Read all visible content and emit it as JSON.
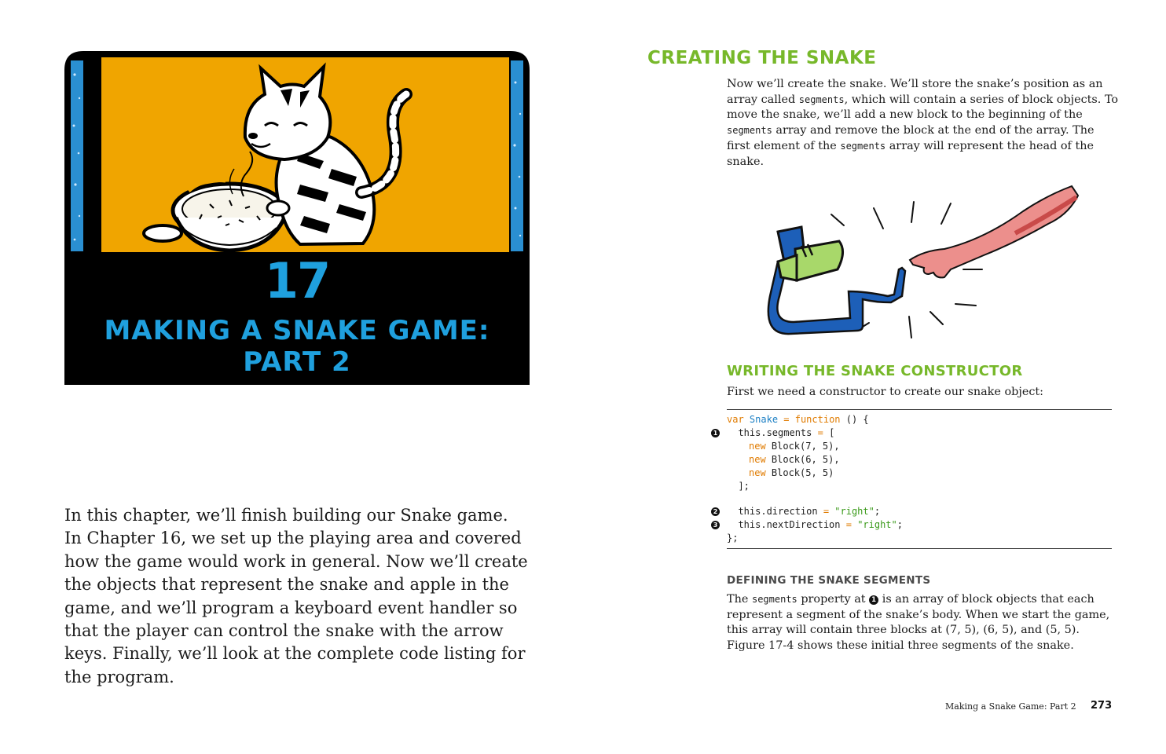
{
  "left_page": {
    "chapter_number": "17",
    "chapter_title_line1": "MAKING A SNAKE GAME:",
    "chapter_title_line2": "PART 2",
    "intro": "In this chapter, we’ll finish building our Snake game. In Chapter 16, we set up the playing area and covered how the game would work in general. Now we’ll create the objects that represent the snake and apple in the game, and we’ll program a keyboard event handler so that the player can control the snake with the arrow keys. Finally, we’ll look at the complete code listing for the program."
  },
  "right_page": {
    "heading": "CREATING THE SNAKE",
    "para1": {
      "a": "Now we’ll create the snake. We’ll store the snake’s position as an array called ",
      "code1": "segments",
      "b": ", which will contain a series of block objects. To move the snake, we’ll add a new block to the beginning of the ",
      "code2": "segments",
      "c": " array and remove the block at the end of the array. The first element of the ",
      "code3": "segments",
      "d": " array will represent the head of the snake."
    },
    "subheading": "WRITING THE SNAKE CONSTRUCTOR",
    "para2": "First we need a constructor to create our snake object:",
    "code": {
      "l1_kw": "var",
      "l1_name": "Snake",
      "l1_eq": " = ",
      "l1_fn": "function",
      "l1_rest": " () {",
      "l2_obj": "  this.segments",
      "l2_eq": " = ",
      "l2_rest": "[",
      "l3_kw": "new",
      "l3_rest": " Block(7, 5),",
      "l4_kw": "new",
      "l4_rest": " Block(6, 5),",
      "l5_kw": "new",
      "l5_rest": " Block(5, 5)",
      "l6": "  ];",
      "l7_obj": "  this.direction",
      "l7_eq": " = ",
      "l7_str": "\"right\"",
      "l7_end": ";",
      "l8_obj": "  this.nextDirection",
      "l8_eq": " = ",
      "l8_str": "\"right\"",
      "l8_end": ";",
      "l9": "};",
      "markers": [
        "1",
        "2",
        "3"
      ]
    },
    "subsubheading": "DEFINING THE SNAKE SEGMENTS",
    "para3": {
      "a": "The ",
      "code1": "segments",
      "b": " property at ",
      "marker": "1",
      "c": " is an array of block objects that each represent a segment of the snake’s body. When we start the game, this array will contain three blocks at (7, 5), (6, 5), and (5, 5). Figure 17-4 shows these initial three segments of the snake."
    },
    "footer_title": "Making a Snake Game: Part 2",
    "page_number": "273"
  },
  "colors": {
    "accent_blue": "#1fa0de",
    "heading_green": "#77b82a",
    "opener_orange": "#f0a500",
    "code_keyword": "#e07b00",
    "code_name": "#1b7fc4",
    "code_string": "#3a9a1a"
  }
}
